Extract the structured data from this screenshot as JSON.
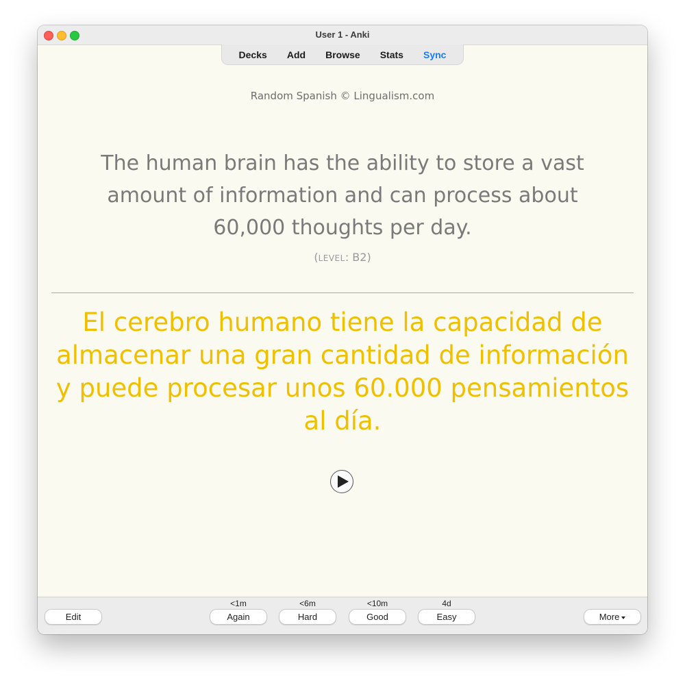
{
  "window": {
    "title": "User 1 - Anki"
  },
  "toolbar": {
    "decks": "Decks",
    "add": "Add",
    "browse": "Browse",
    "stats": "Stats",
    "sync": "Sync"
  },
  "card": {
    "credit": "Random Spanish © Lingualism.com",
    "question": "The human brain has the ability to store a vast amount of information and can process about 60,000 thoughts per day.",
    "level_prefix": "(",
    "level_label": "LEVEL",
    "level_value": ": B2)",
    "answer": "El cerebro humano tiene la capacidad de almacenar una gran cantidad de información y puede procesar unos 60.000 pensamientos al día."
  },
  "bottom": {
    "edit": "Edit",
    "more": "More",
    "answers": [
      {
        "interval": "<1m",
        "label": "Again"
      },
      {
        "interval": "<6m",
        "label": "Hard"
      },
      {
        "interval": "<10m",
        "label": "Good"
      },
      {
        "interval": "4d",
        "label": "Easy"
      }
    ]
  },
  "icons": {
    "play": "play-icon",
    "more_caret": "chevron-down-icon"
  },
  "colors": {
    "answer_text": "#f0bf00",
    "sync_link": "#1a7cf2",
    "card_background": "#fafaf0"
  }
}
